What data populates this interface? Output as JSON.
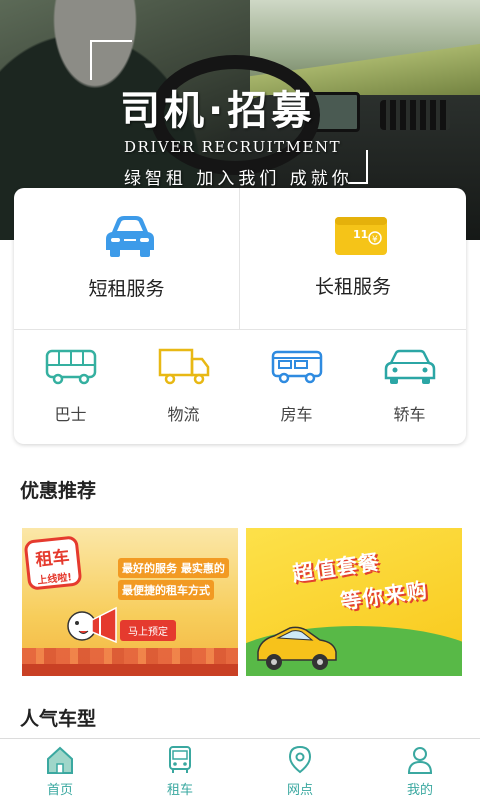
{
  "banner": {
    "title": "司机·招募",
    "subtitle": "DRIVER RECRUITMENT",
    "tagline": "绿智租 加入我们 成就你"
  },
  "services": {
    "short_rent": "短租服务",
    "long_rent": "长租服务",
    "wallet_text": "11 ¥",
    "categories": [
      "巴士",
      "物流",
      "房车",
      "轿车"
    ]
  },
  "sections": {
    "promotions": "优惠推荐",
    "popular": "人气车型"
  },
  "promo1": {
    "badge_big": "租车",
    "badge_small": "上线啦!",
    "line1": "最好的服务 最实惠的",
    "line2": "最便捷的租车方式",
    "button": "马上预定"
  },
  "promo2": {
    "title1": "超值套餐",
    "title2": "等你来购"
  },
  "nav": {
    "items": [
      "首页",
      "租车",
      "网点",
      "我的"
    ]
  },
  "colors": {
    "accent": "#3aa8a0",
    "blue_car": "#3d9be9",
    "yellow": "#f5c418"
  }
}
